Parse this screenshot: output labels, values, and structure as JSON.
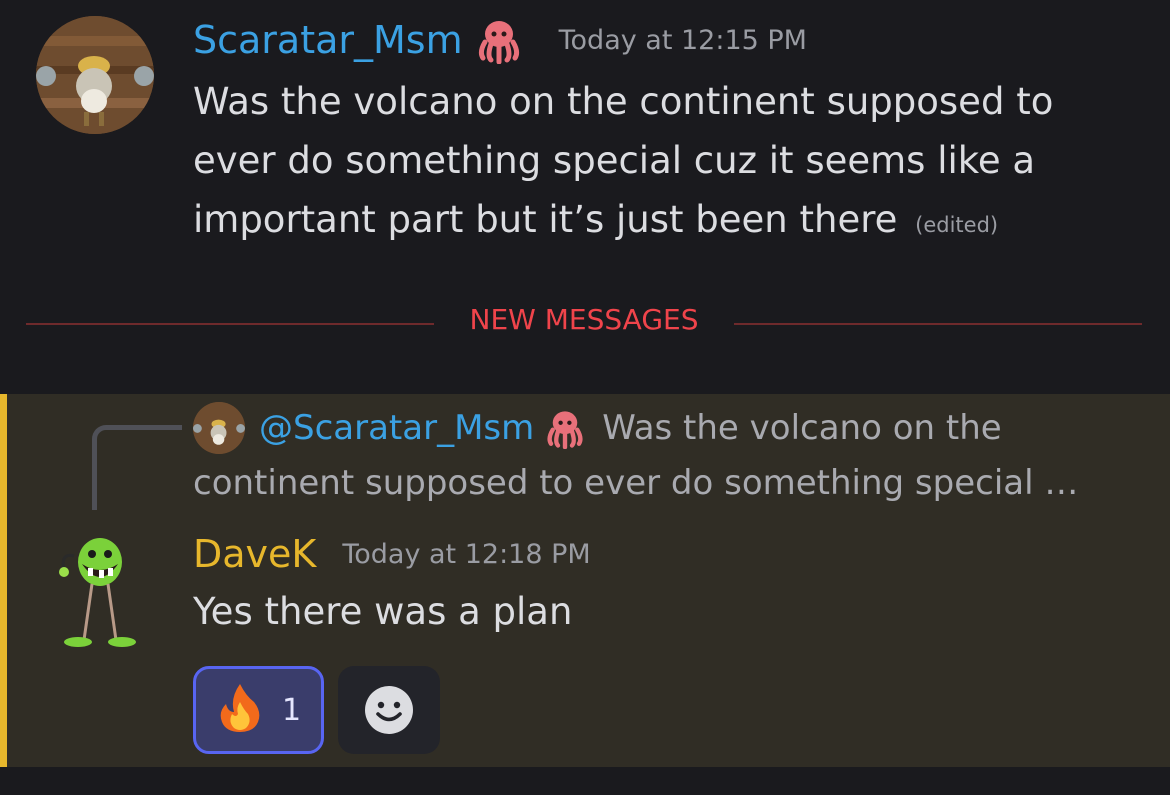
{
  "message_1": {
    "author": "Scaratar_Msm",
    "author_badge_icon": "octopus-icon",
    "timestamp": "Today at 12:15 PM",
    "text": "Was the volcano on the continent supposed to ever do something special cuz it seems like a important part but it’s just been there",
    "edited_label": "(edited)"
  },
  "divider": {
    "label": "NEW MESSAGES"
  },
  "message_2": {
    "reply": {
      "mention": "@Scaratar_Msm",
      "text_line1": "Was the volcano on the",
      "text_line2": "continent supposed to ever do something special …"
    },
    "author": "DaveK",
    "timestamp": "Today at 12:18 PM",
    "text": "Yes there was a plan",
    "reactions": [
      {
        "emoji_icon": "fire-icon",
        "count": "1"
      }
    ]
  },
  "colors": {
    "background": "#1a1a1e",
    "mention_highlight": "#302d25",
    "mention_bar": "#e7b72c",
    "username_blue": "#3ba1e3",
    "username_gold": "#e7b72c",
    "new_messages_red": "#f0444b",
    "reaction_active_border": "#5865f2"
  }
}
